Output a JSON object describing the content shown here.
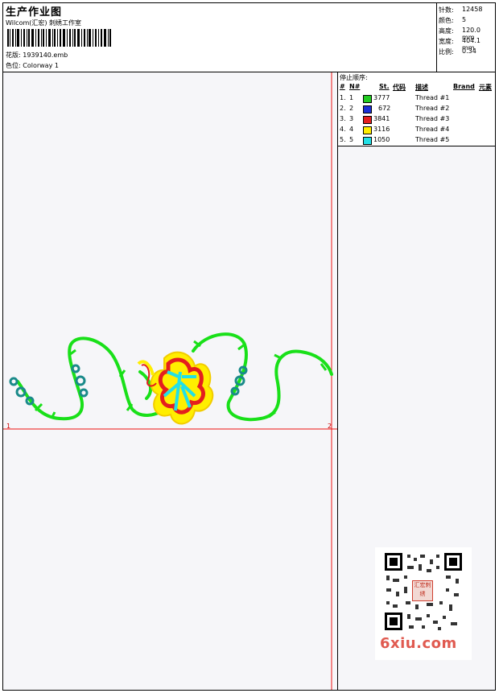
{
  "header": {
    "title": "生产作业图",
    "company": "Wilcom(汇宏) 刺绣工作室",
    "design_label": "花版:",
    "design_value": "1939140.emb",
    "colorway_label": "色位:",
    "colorway_value": "Colorway 1"
  },
  "stats": [
    {
      "label": "针数:",
      "value": "12458"
    },
    {
      "label": "颜色:",
      "value": "5"
    },
    {
      "label": "高度:",
      "value": "120.0 mm"
    },
    {
      "label": "宽度:",
      "value": "404.1 mm"
    },
    {
      "label": "比例:",
      "value": "0.34"
    }
  ],
  "legend": {
    "title": "停止顺序:",
    "headers": {
      "hash": "#",
      "num": "N#",
      "st": "St.",
      "code": "代码",
      "desc": "描述",
      "brand": "Brand",
      "elem": "元素"
    },
    "rows": [
      {
        "idx": "1.",
        "n": "1",
        "color": "#22cc22",
        "code": "3777",
        "desc": "Thread #1"
      },
      {
        "idx": "2.",
        "n": "2",
        "color": "#1a2fd6",
        "code": "672",
        "desc": "Thread #2"
      },
      {
        "idx": "3.",
        "n": "3",
        "color": "#e41e1e",
        "code": "3841",
        "desc": "Thread #3"
      },
      {
        "idx": "4.",
        "n": "4",
        "color": "#ffee00",
        "code": "3116",
        "desc": "Thread #4"
      },
      {
        "idx": "5.",
        "n": "5",
        "color": "#22e0e6",
        "code": "1050",
        "desc": "Thread #5"
      }
    ]
  },
  "markers": {
    "start": "1",
    "end": "2"
  },
  "watermark": {
    "site": "6xiu.com",
    "stamp": "汇宏刺绣"
  }
}
